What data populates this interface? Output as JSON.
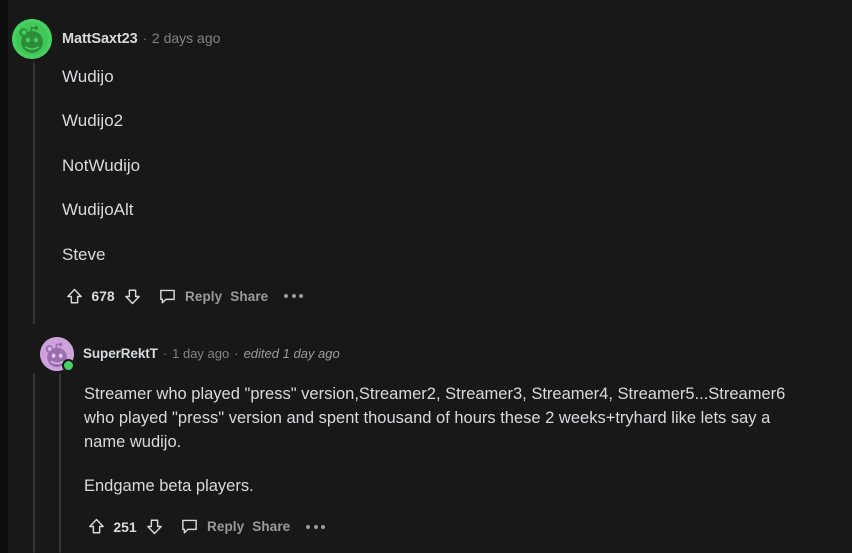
{
  "theme": {
    "background": "#181819",
    "gutter": "#0d0d0e",
    "text_primary": "#d7dadc",
    "text_muted": "#818384",
    "thread_line": "#343536",
    "avatar_green": "#46d160",
    "avatar_purple": "#cda2dd",
    "online_green": "#46d160"
  },
  "comments": [
    {
      "author": "MattSaxt23",
      "timestamp": "2 days ago",
      "separator": "·",
      "avatar_icon": "snoo-avatar-green",
      "online": false,
      "paragraphs": [
        "Wudijo",
        "Wudijo2",
        "NotWudijo",
        "WudijoAlt",
        "Steve"
      ],
      "actions": {
        "upvote_icon": "upvote-arrow-icon",
        "score": "678",
        "downvote_icon": "downvote-arrow-icon",
        "comment_icon": "comment-bubble-icon",
        "reply_label": "Reply",
        "share_label": "Share",
        "more_icon": "more-options-icon"
      }
    },
    {
      "author": "SuperRektT",
      "timestamp": "1 day ago",
      "separator": "·",
      "edited": "edited 1 day ago",
      "avatar_icon": "snoo-avatar-purple",
      "online": true,
      "paragraphs": [
        "Streamer who played \"press\" version,Streamer2, Streamer3, Streamer4, Streamer5...Streamer6 who played \"press\" version and spent thousand of hours these 2 weeks+tryhard like lets say a name wudijo.",
        "Endgame beta players."
      ],
      "actions": {
        "upvote_icon": "upvote-arrow-icon",
        "score": "251",
        "downvote_icon": "downvote-arrow-icon",
        "comment_icon": "comment-bubble-icon",
        "reply_label": "Reply",
        "share_label": "Share",
        "more_icon": "more-options-icon"
      }
    }
  ]
}
